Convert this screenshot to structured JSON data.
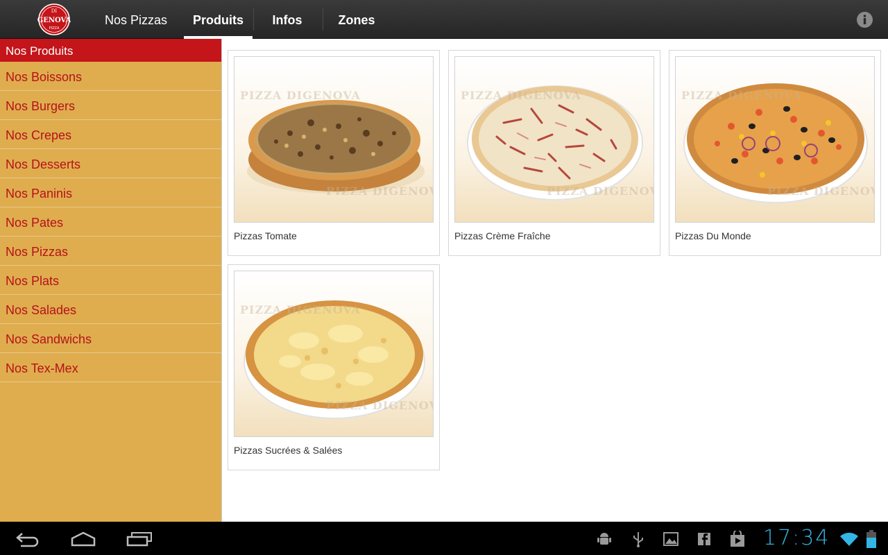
{
  "app": {
    "logo_text": [
      "DI",
      "GENOVA",
      "PIZZA"
    ]
  },
  "tabs": [
    {
      "label": "Nos Pizzas",
      "selected": false
    },
    {
      "label": "Produits",
      "selected": true
    },
    {
      "label": "Infos",
      "selected": false
    },
    {
      "label": "Zones",
      "selected": false
    }
  ],
  "sidebar": {
    "header": "Nos Produits",
    "items": [
      "Nos Boissons",
      "Nos Burgers",
      "Nos Crepes",
      "Nos Desserts",
      "Nos Paninis",
      "Nos Pates",
      "Nos Pizzas",
      "Nos Plats",
      "Nos Salades",
      "Nos Sandwichs",
      "Nos Tex-Mex"
    ]
  },
  "products": [
    {
      "label": "Pizzas Tomate",
      "watermark": "PIZZA DIGENOVA"
    },
    {
      "label": "Pizzas Crème Fraîche",
      "watermark": "PIZZA DIGENOVA"
    },
    {
      "label": "Pizzas Du Monde",
      "watermark": "PIZZA DIGENOVA"
    },
    {
      "label": "Pizzas Sucrées & Salées",
      "watermark": "PIZZA DIGENOVA"
    }
  ],
  "status": {
    "time": "17:34"
  },
  "colors": {
    "action_bar": "#2b2b2b",
    "sidebar_bg": "#dfad4e",
    "sidebar_header": "#c4151a",
    "sidebar_text": "#b6121a",
    "clock": "#33b5e5"
  },
  "icons": [
    "app-logo",
    "info-icon",
    "back-icon",
    "home-icon",
    "recent-apps-icon",
    "android-debug-icon",
    "usb-icon",
    "gallery-icon",
    "facebook-icon",
    "play-store-icon",
    "wifi-icon",
    "battery-icon"
  ]
}
